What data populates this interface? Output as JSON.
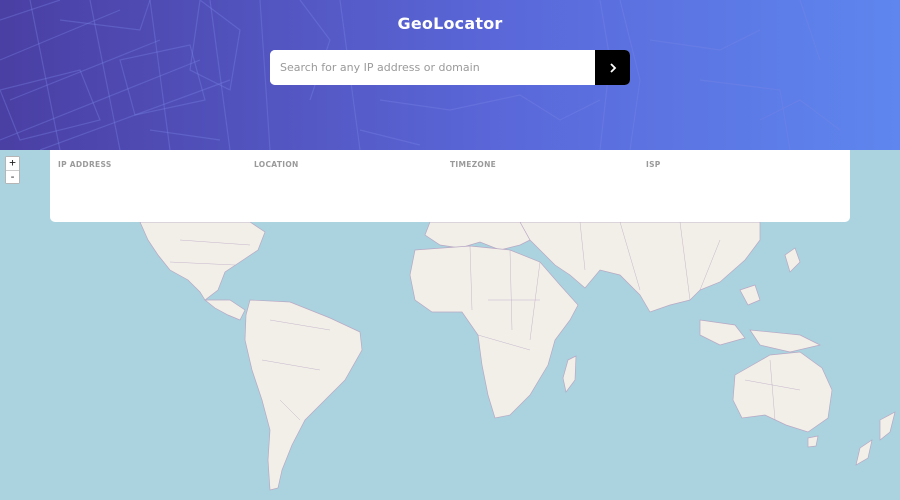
{
  "app": {
    "title": "GeoLocator"
  },
  "search": {
    "placeholder": "Search for any IP address or domain",
    "value": "",
    "submit_icon": "chevron-right-icon"
  },
  "info": {
    "fields": [
      {
        "label": "IP ADDRESS",
        "value": ""
      },
      {
        "label": "LOCATION",
        "value": ""
      },
      {
        "label": "TIMEZONE",
        "value": ""
      },
      {
        "label": "ISP",
        "value": ""
      }
    ]
  },
  "map": {
    "zoom_in_label": "+",
    "zoom_out_label": "-",
    "colors": {
      "water": "#aad3df",
      "land": "#f2efe9",
      "border": "#b9a8c4"
    }
  },
  "colors": {
    "header_start": "#4a3fa3",
    "header_end": "#5e86ee",
    "button": "#000000"
  }
}
